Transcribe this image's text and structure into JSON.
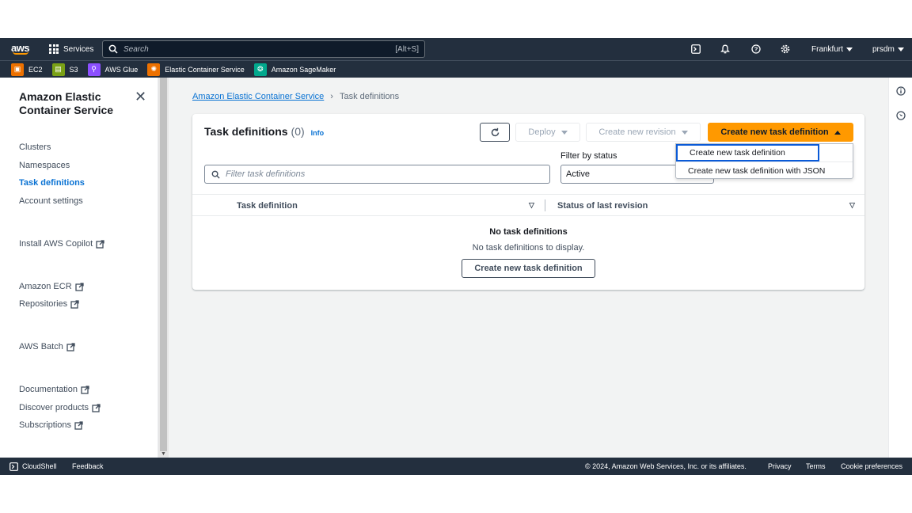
{
  "topnav": {
    "logo": "aws",
    "services_label": "Services",
    "search_placeholder": "Search",
    "search_shortcut": "[Alt+S]",
    "region": "Frankfurt",
    "account": "prsdm"
  },
  "favorites": [
    {
      "label": "EC2",
      "color": "#ed7100"
    },
    {
      "label": "S3",
      "color": "#7aa116"
    },
    {
      "label": "AWS Glue",
      "color": "#8c4fff"
    },
    {
      "label": "Elastic Container Service",
      "color": "#ed7100"
    },
    {
      "label": "Amazon SageMaker",
      "color": "#01a88d"
    }
  ],
  "sidebar": {
    "title": "Amazon Elastic Container Service",
    "items": [
      {
        "label": "Clusters"
      },
      {
        "label": "Namespaces"
      },
      {
        "label": "Task definitions"
      },
      {
        "label": "Account settings"
      },
      {
        "label": "Install AWS Copilot"
      },
      {
        "label": "Amazon ECR"
      },
      {
        "label": "Repositories"
      },
      {
        "label": "AWS Batch"
      },
      {
        "label": "Documentation"
      },
      {
        "label": "Discover products"
      },
      {
        "label": "Subscriptions"
      }
    ]
  },
  "breadcrumb": {
    "parent": "Amazon Elastic Container Service",
    "current": "Task definitions"
  },
  "card": {
    "title": "Task definitions",
    "count": "(0)",
    "info": "Info",
    "deploy_label": "Deploy",
    "create_revision_label": "Create new revision",
    "create_label": "Create new task definition",
    "filter_label": "Filter by status",
    "filter_placeholder": "Filter task definitions",
    "filter_value": "Active",
    "columns": [
      "Task definition",
      "Status of last revision"
    ],
    "empty_title": "No task definitions",
    "empty_sub": "No task definitions to display.",
    "empty_button": "Create new task definition"
  },
  "dropdown": {
    "items": [
      "Create new task definition",
      "Create new task definition with JSON"
    ]
  },
  "footer": {
    "cloudshell": "CloudShell",
    "feedback": "Feedback",
    "copyright": "© 2024, Amazon Web Services, Inc. or its affiliates.",
    "privacy": "Privacy",
    "terms": "Terms",
    "cookies": "Cookie preferences"
  },
  "colors": {
    "nav_bg": "#232f3e",
    "primary": "#ff9900",
    "link": "#0972d3",
    "highlight": "#0a5ad7"
  }
}
